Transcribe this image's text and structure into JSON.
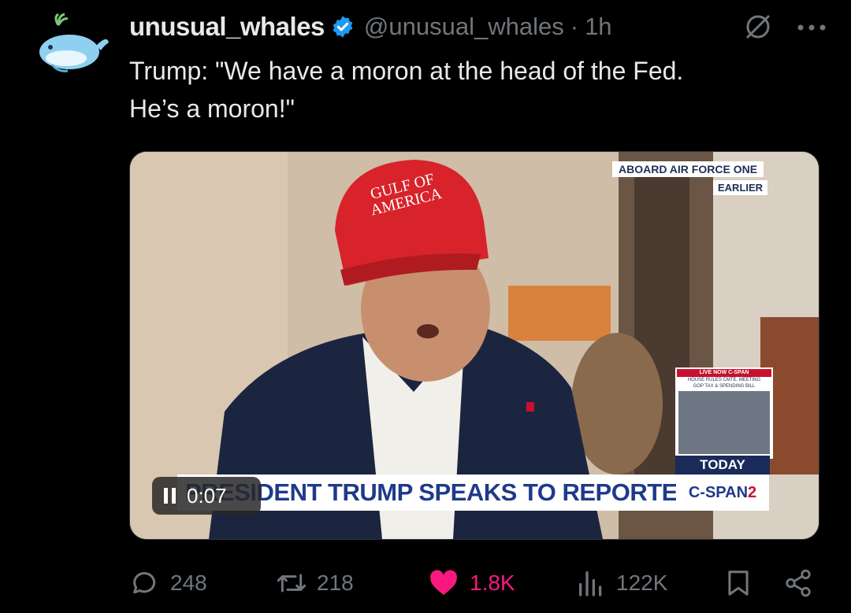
{
  "author": {
    "display_name": "unusual_whales",
    "handle": "@unusual_whales",
    "separator": "·",
    "time": "1h"
  },
  "tweet": {
    "text_line1": "Trump: \"We have a moron at the head of the Fed.",
    "text_line2": "He’s a moron!\""
  },
  "media": {
    "chyron_top": "ABOARD AIR FORCE ONE",
    "chyron_top_sub": "EARLIER",
    "live_header": "LIVE NOW C-SPAN",
    "live_sub1": "HOUSE RULES CMTE. MEETING",
    "live_sub2": "GOP TAX & SPENDING BILL",
    "today": "TODAY",
    "lower_third": "PRESIDENT TRUMP SPEAKS TO REPORTERS",
    "network": "C-SPAN",
    "network_num": "2",
    "hat_line1": "GULF OF",
    "hat_line2": "AMERICA",
    "video_time": "0:07"
  },
  "actions": {
    "replies": "248",
    "reposts": "218",
    "likes": "1.8K",
    "views": "122K"
  },
  "colors": {
    "background": "#000000",
    "muted": "#71767b",
    "like": "#f91880",
    "verified": "#1d9bf0"
  },
  "icons": [
    "whale-avatar",
    "verified-badge-icon",
    "grok-icon",
    "more-icon",
    "pause-icon",
    "reply-icon",
    "repost-icon",
    "like-icon",
    "views-icon",
    "bookmark-icon",
    "share-icon"
  ]
}
